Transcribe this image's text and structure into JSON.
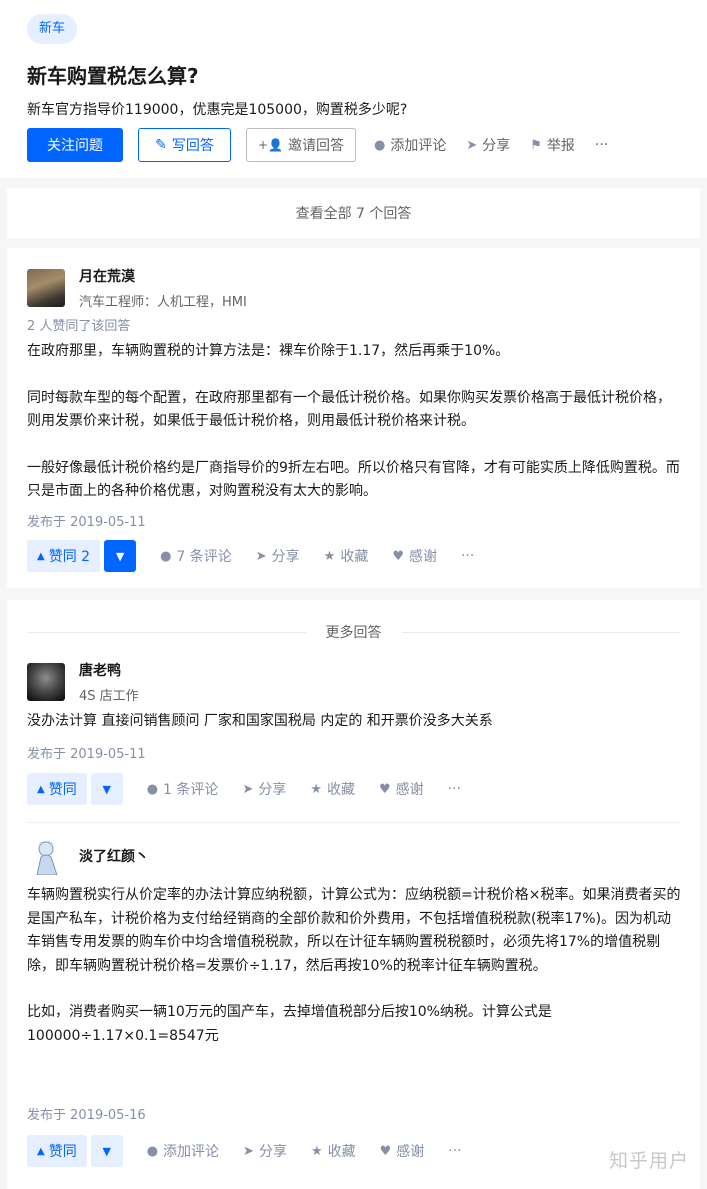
{
  "question": {
    "tag": "新车",
    "title": "新车购置税怎么算?",
    "description": "新车官方指导价119000，优惠完是105000，购置税多少呢?",
    "actions": {
      "follow": "关注问题",
      "write": "写回答",
      "invite": "邀请回答",
      "comment": "添加评论",
      "share": "分享",
      "report": "举报",
      "more": "···"
    }
  },
  "view_all": "查看全部 7 个回答",
  "answers": [
    {
      "author": "月在荒漠",
      "bio": "汽车工程师：人机工程，HMI",
      "voters": "2 人赞同了该回答",
      "paragraphs": [
        "在政府那里，车辆购置税的计算方法是：裸车价除于1.17，然后再乘于10%。",
        "同时每款车型的每个配置，在政府那里都有一个最低计税价格。如果你购买发票价格高于最低计税价格，则用发票价来计税，如果低于最低计税价格，则用最低计税价格来计税。",
        "一般好像最低计税价格约是厂商指导价的9折左右吧。所以价格只有官降，才有可能实质上降低购置税。而只是市面上的各种价格优惠，对购置税没有太大的影响。"
      ],
      "published": "发布于 2019-05-11",
      "upvote": "赞同 2",
      "comments": "7 条评论",
      "share": "分享",
      "collect": "收藏",
      "thanks": "感谢",
      "more": "···"
    },
    {
      "author": "唐老鸭",
      "bio": "4S 店工作",
      "paragraphs": [
        "没办法计算 直接问销售顾问 厂家和国家国税局 内定的 和开票价没多大关系"
      ],
      "published": "发布于 2019-05-11",
      "upvote": "赞同",
      "comments": "1 条评论",
      "share": "分享",
      "collect": "收藏",
      "thanks": "感谢",
      "more": "···"
    },
    {
      "author": "淡了红颜丶",
      "paragraphs": [
        "车辆购置税实行从价定率的办法计算应纳税额，计算公式为：应纳税额=计税价格×税率。如果消费者买的是国产私车，计税价格为支付给经销商的全部价款和价外费用，不包括增值税税款(税率17%)。因为机动车销售专用发票的购车价中均含增值税税款，所以在计征车辆购置税税额时，必须先将17%的增值税剔除，即车辆购置税计税价格=发票价÷1.17，然后再按10%的税率计征车辆购置税。",
        "比如，消费者购买一辆10万元的国产车，去掉增值税部分后按10%纳税。计算公式是100000÷1.17×0.1=8547元"
      ],
      "published": "发布于 2019-05-16",
      "upvote": "赞同",
      "comments": "添加评论",
      "share": "分享",
      "collect": "收藏",
      "thanks": "感谢",
      "more": "···"
    }
  ],
  "more_answers_label": "更多回答",
  "watermark": "知乎用户",
  "icons": {
    "pencil": "pencil-icon",
    "invite": "add-user-icon",
    "comment": "comment-bubble-icon",
    "share": "paper-plane-icon",
    "report": "flag-icon",
    "collect": "star-icon",
    "thanks": "heart-icon",
    "upvote": "triangle-up-icon",
    "downvote": "triangle-down-icon"
  },
  "colors": {
    "brand_blue": "#0066ff",
    "light_blue": "#e5efff",
    "muted_text": "#8590a6"
  }
}
